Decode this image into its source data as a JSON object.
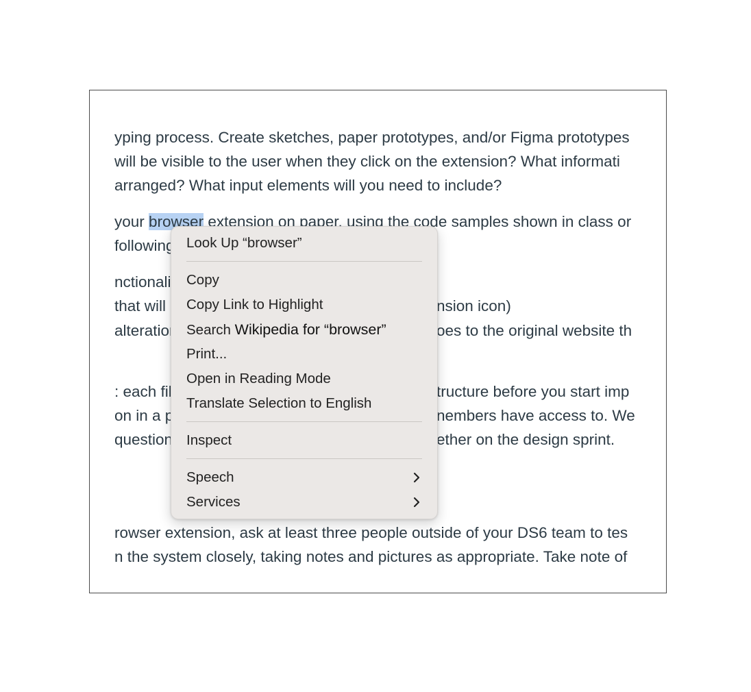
{
  "document": {
    "lines": [
      "yping process. Create sketches, paper prototypes, and/or Figma prototypes",
      "will be visible to the user when they click on the extension? What informati",
      " arranged? What input elements will you need to include?",
      "",
      " following",
      "nctionality",
      " that will",
      " alteration",
      ": each file",
      "on in a p",
      "question",
      "rowser extension, ask at least three people outside of your DS6 team to tes",
      "n the system closely, taking notes and pictures as appropriate. Take note of"
    ],
    "line4_before": "your ",
    "line4_highlight": "browser",
    "line4_after": " extension on paper, using the code samples shown in class or",
    "right_fragments": [
      "nsion icon)",
      "oes to the original website th",
      "tructure before you start imp",
      "nembers have access to. We ",
      "ether on the design sprint."
    ]
  },
  "context_menu": {
    "look_up": "Look Up “browser”",
    "copy": "Copy",
    "copy_link": "Copy Link to Highlight",
    "search_prefix": "Search",
    "search_target": "Wikipedia for “browser”",
    "print": "Print...",
    "reading_mode": "Open in Reading Mode",
    "translate": "Translate Selection to English",
    "inspect": "Inspect",
    "speech": "Speech",
    "services": "Services"
  }
}
